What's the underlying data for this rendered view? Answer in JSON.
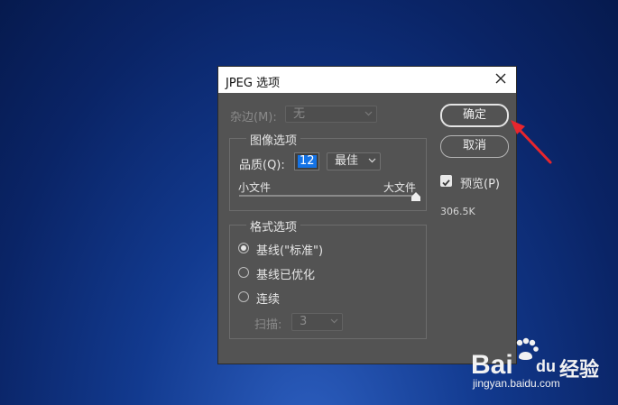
{
  "dialog": {
    "title": "JPEG 选项",
    "matte": {
      "label": "杂边(M):",
      "value": "无"
    },
    "image_options": {
      "title": "图像选项",
      "quality_label": "品质(Q):",
      "quality_value": "12",
      "quality_preset": "最佳",
      "small_file": "小文件",
      "large_file": "大文件",
      "slider_level": 1.0
    },
    "format_options": {
      "title": "格式选项",
      "options": [
        {
          "label": "基线(\"标准\")",
          "checked": true
        },
        {
          "label": "基线已优化",
          "checked": false
        },
        {
          "label": "连续",
          "checked": false
        }
      ],
      "scans_label": "扫描:",
      "scans_value": "3"
    },
    "ok_label": "确定",
    "cancel_label": "取消",
    "preview_label": "预览(P)",
    "preview_checked": true,
    "file_size": "306.5K"
  },
  "watermark": {
    "brand_main": "Bai",
    "brand_du": "du",
    "brand_suffix": "经验",
    "url": "jingyan.baidu.com"
  },
  "colors": {
    "dialog_bg": "#535353",
    "accent": "#1473e6",
    "arrow": "#e8262d"
  }
}
